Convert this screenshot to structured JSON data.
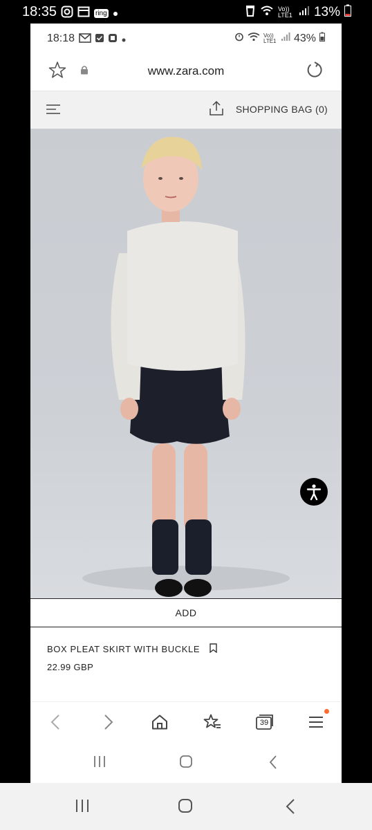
{
  "outer_status": {
    "time": "18:35",
    "ring_label": "ring",
    "network": "Vo)) LTE1",
    "battery": "13%"
  },
  "inner_status": {
    "time": "18:18",
    "network": "Vo)) LTE1",
    "battery": "43%"
  },
  "browser": {
    "url": "www.zara.com"
  },
  "header": {
    "bag_label": "SHOPPING BAG (0)"
  },
  "product": {
    "add_label": "ADD",
    "name": "BOX PLEAT SKIRT WITH BUCKLE",
    "price": "22.99 GBP"
  },
  "tabs": {
    "count": "39"
  },
  "colors": {
    "notification_dot": "#ff6a2e",
    "battery_low": "#e53935"
  }
}
